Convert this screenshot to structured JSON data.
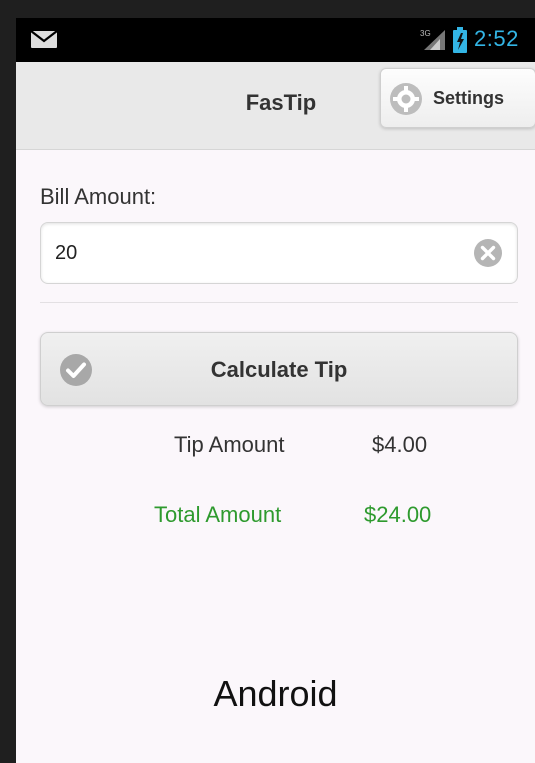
{
  "status_bar": {
    "time": "2:52",
    "icons": [
      "mail-icon",
      "signal-3g-icon",
      "battery-icon"
    ],
    "accent_color": "#33b5e5"
  },
  "header": {
    "title": "FasTip",
    "settings_label": "Settings",
    "settings_icon": "gear-icon"
  },
  "form": {
    "bill_label": "Bill Amount:",
    "bill_value": "20",
    "clear_icon": "clear-icon",
    "calculate_label": "Calculate Tip",
    "calculate_icon": "check-icon"
  },
  "results": {
    "tip_label": "Tip Amount",
    "tip_value": "$4.00",
    "total_label": "Total Amount",
    "total_value": "$24.00",
    "total_color": "#2e9a2e"
  },
  "footer": {
    "brand": "Android"
  }
}
